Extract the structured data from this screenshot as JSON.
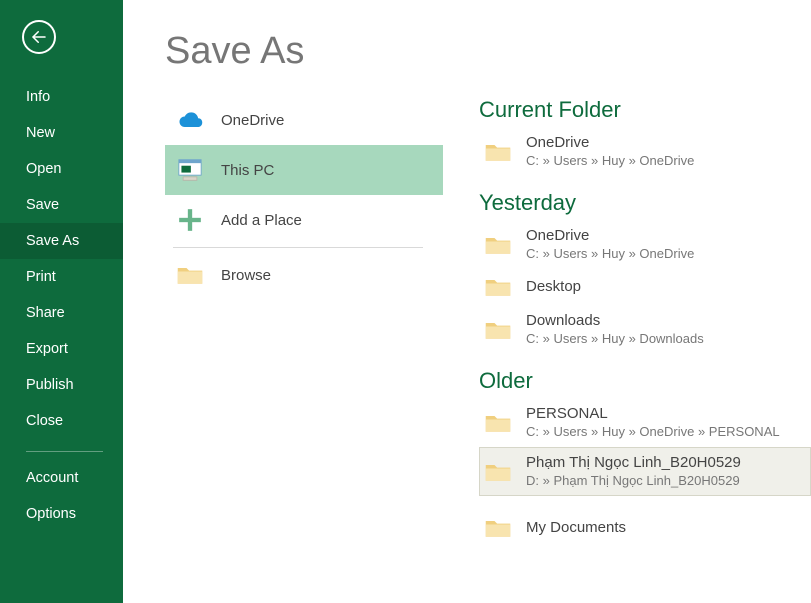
{
  "page_title": "Save As",
  "sidebar": {
    "items": [
      {
        "label": "Info",
        "active": false
      },
      {
        "label": "New",
        "active": false
      },
      {
        "label": "Open",
        "active": false
      },
      {
        "label": "Save",
        "active": false
      },
      {
        "label": "Save As",
        "active": true
      },
      {
        "label": "Print",
        "active": false
      },
      {
        "label": "Share",
        "active": false
      },
      {
        "label": "Export",
        "active": false
      },
      {
        "label": "Publish",
        "active": false
      },
      {
        "label": "Close",
        "active": false
      }
    ],
    "footer": [
      {
        "label": "Account"
      },
      {
        "label": "Options"
      }
    ]
  },
  "places": [
    {
      "id": "onedrive",
      "label": "OneDrive",
      "icon": "onedrive-icon",
      "selected": false
    },
    {
      "id": "this-pc",
      "label": "This PC",
      "icon": "pc-icon",
      "selected": true
    },
    {
      "id": "add-place",
      "label": "Add a Place",
      "icon": "add-icon",
      "selected": false
    },
    {
      "id": "browse",
      "label": "Browse",
      "icon": "folder-icon",
      "selected": false
    }
  ],
  "location_groups": [
    {
      "header": "Current Folder",
      "items": [
        {
          "name": "OneDrive",
          "path": "C: » Users » Huy » OneDrive",
          "highlight": false
        }
      ]
    },
    {
      "header": "Yesterday",
      "items": [
        {
          "name": "OneDrive",
          "path": "C: » Users » Huy » OneDrive",
          "highlight": false
        },
        {
          "name": "Desktop",
          "path": "",
          "highlight": false
        },
        {
          "name": "Downloads",
          "path": "C: » Users » Huy » Downloads",
          "highlight": false
        }
      ]
    },
    {
      "header": "Older",
      "items": [
        {
          "name": "PERSONAL",
          "path": "C: » Users » Huy » OneDrive » PERSONAL",
          "highlight": false
        },
        {
          "name": "Phạm Thị Ngọc Linh_B20H0529",
          "path": "D: » Phạm Thị Ngọc Linh_B20H0529",
          "highlight": true
        },
        {
          "name": "My Documents",
          "path": "",
          "highlight": false
        }
      ]
    }
  ]
}
